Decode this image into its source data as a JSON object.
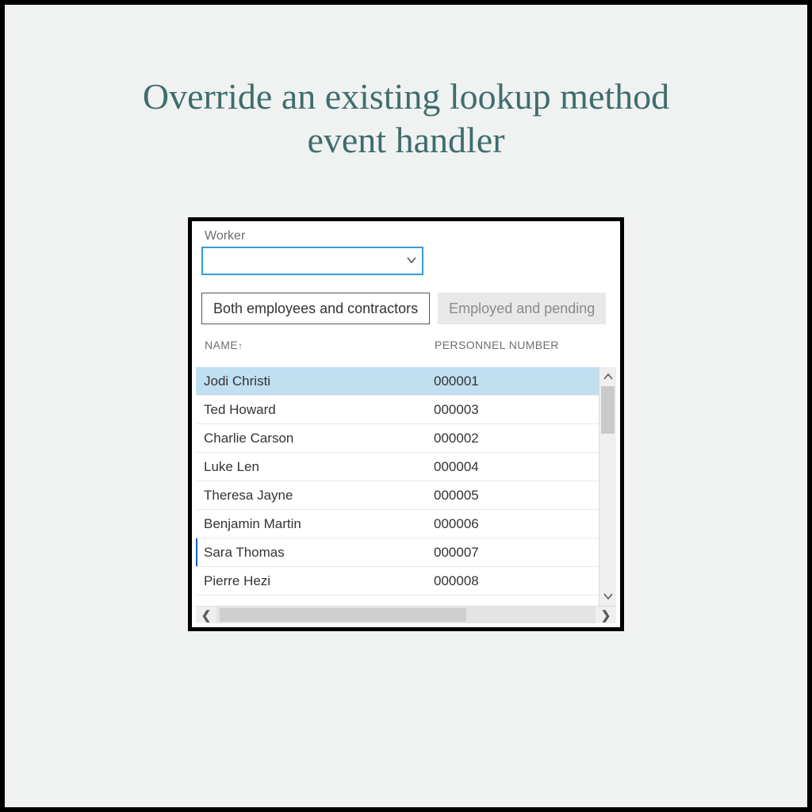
{
  "title": "Override an existing lookup method event handler",
  "field_label": "Worker",
  "combo_value": "",
  "tabs": {
    "active": "Both employees and contractors",
    "inactive": "Employed and pending"
  },
  "columns": {
    "name": "NAME",
    "sort_indicator": "↑",
    "personnel": "PERSONNEL NUMBER"
  },
  "rows": [
    {
      "name": "Jodi Christi",
      "num": "000001",
      "selected": true
    },
    {
      "name": "Ted Howard",
      "num": "000003"
    },
    {
      "name": "Charlie Carson",
      "num": "000002"
    },
    {
      "name": "Luke Len",
      "num": "000004"
    },
    {
      "name": "Theresa Jayne",
      "num": "000005"
    },
    {
      "name": "Benjamin Martin",
      "num": "000006"
    },
    {
      "name": "Sara Thomas",
      "num": "000007",
      "highlight_bar": true
    },
    {
      "name": "Pierre Hezi",
      "num": "000008"
    }
  ]
}
